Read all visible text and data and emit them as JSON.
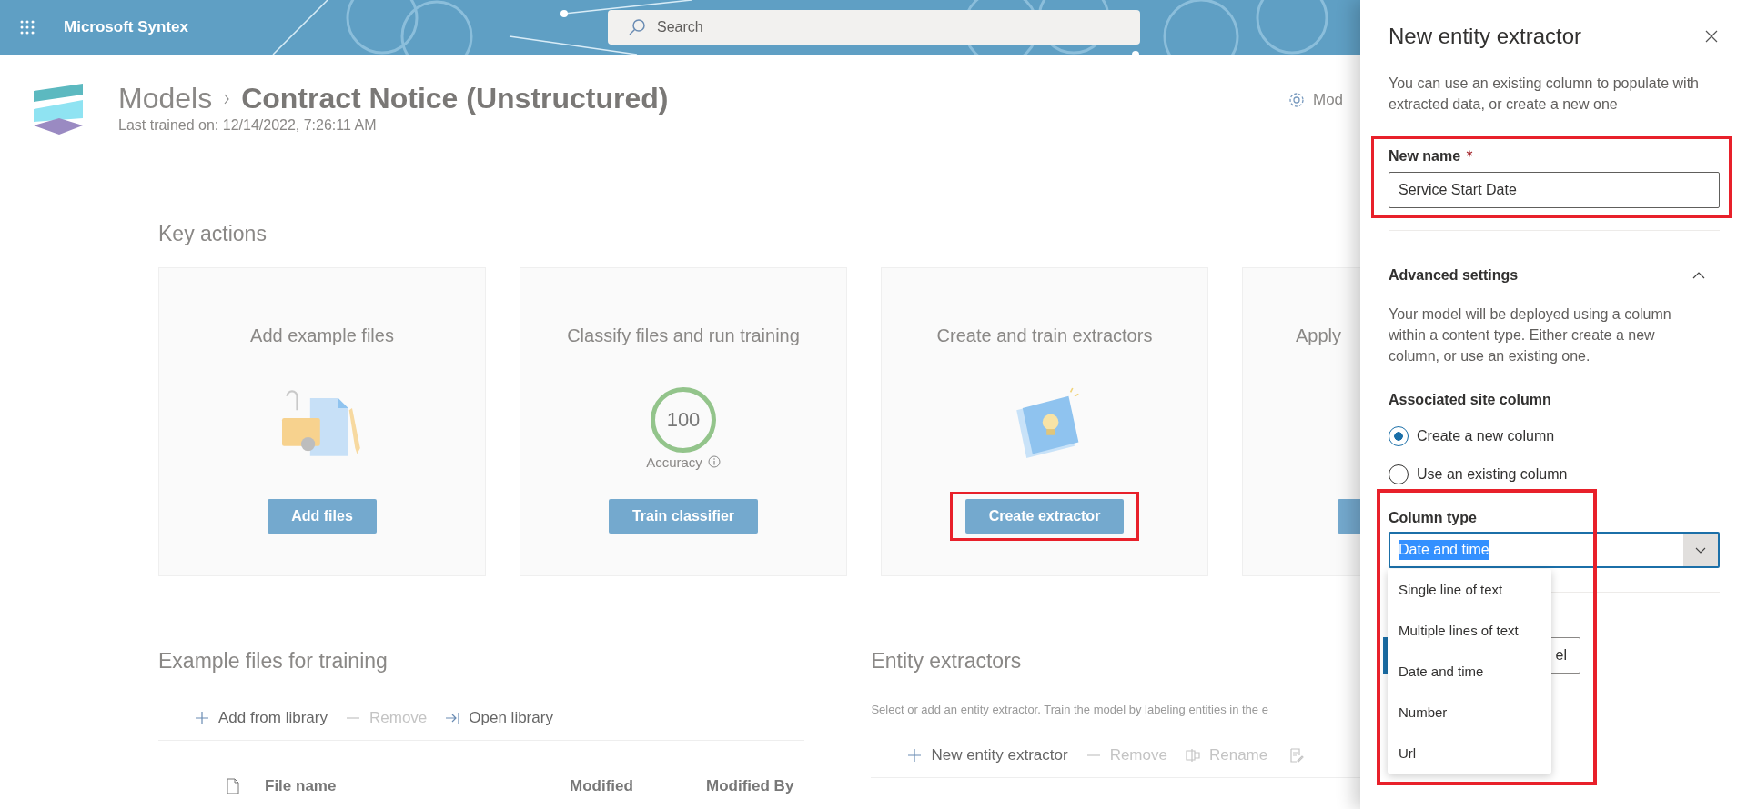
{
  "app_bar": {
    "app_name": "Microsoft Syntex",
    "search": {
      "placeholder": "Search"
    }
  },
  "header": {
    "breadcrumb": "Models",
    "title": "Contract Notice (Unstructured)",
    "subtitle": "Last trained on: 12/14/2022, 7:26:11 AM",
    "settings_link": "Mod"
  },
  "key_actions": {
    "title": "Key actions",
    "cards": [
      {
        "kind": "files",
        "title": "Add example files",
        "button": "Add files",
        "highlighted": false
      },
      {
        "kind": "accuracy",
        "title": "Classify files and run training",
        "score": "100",
        "score_label": "Accuracy",
        "button": "Train classifier",
        "highlighted": false
      },
      {
        "kind": "extractor",
        "title": "Create and train extractors",
        "button": "Create extractor",
        "highlighted": true
      },
      {
        "kind": "apply",
        "title": "Apply"
      }
    ]
  },
  "example_files": {
    "title": "Example files for training",
    "toolbar": [
      {
        "kind": "add",
        "label": "Add from library",
        "disabled": false
      },
      {
        "kind": "remove",
        "label": "Remove",
        "disabled": true
      },
      {
        "kind": "open",
        "label": "Open library",
        "disabled": false
      }
    ],
    "columns": [
      "File name",
      "Modified",
      "Modified By"
    ]
  },
  "entity_extractors": {
    "title": "Entity extractors",
    "description": "Select or add an entity extractor. Train the model by labeling entities in the e",
    "toolbar": [
      {
        "kind": "add",
        "label": "New entity extractor",
        "disabled": false
      },
      {
        "kind": "remove",
        "label": "Remove",
        "disabled": true
      },
      {
        "kind": "rename",
        "label": "Rename",
        "disabled": true
      }
    ]
  },
  "panel": {
    "title": "New entity extractor",
    "description": "You can use an existing column to populate with extracted data, or create a new one",
    "name_field": {
      "label": "New name",
      "required": true,
      "value": "Service Start Date",
      "highlighted": true
    },
    "advanced": {
      "title": "Advanced settings",
      "expanded": true,
      "description": "Your model will be deployed using a column within a content type. Either create a new column, or use an existing one.",
      "site_column": {
        "label": "Associated site column",
        "options": [
          {
            "label": "Create a new column",
            "selected": true
          },
          {
            "label": "Use an existing column",
            "selected": false
          }
        ]
      },
      "column_type": {
        "label": "Column type",
        "value": "Date and time",
        "text_selected": true,
        "open": true,
        "highlighted": true,
        "options": [
          "Single line of text",
          "Multiple lines of text",
          "Date and time",
          "Number",
          "Url"
        ]
      }
    },
    "hidden_button_text": "el"
  }
}
